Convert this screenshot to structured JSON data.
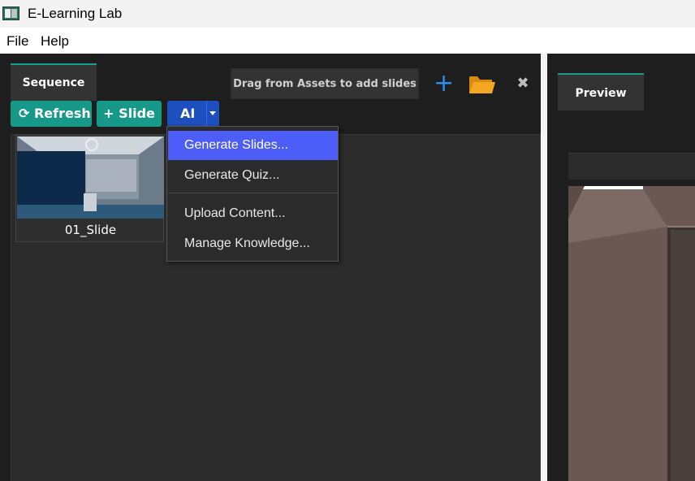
{
  "window": {
    "title": "E-Learning Lab"
  },
  "menu": {
    "items": [
      "File",
      "Help"
    ]
  },
  "sequence": {
    "tab_label": "Sequence",
    "drag_hint": "Drag from Assets to add slides",
    "refresh_label": "Refresh",
    "add_slide_label": "+ Slide",
    "ai_label": "AI",
    "slides": [
      {
        "label": "01_Slide"
      }
    ]
  },
  "ai_menu": {
    "items": [
      "Generate Slides...",
      "Generate Quiz...",
      "Upload Content...",
      "Manage Knowledge..."
    ],
    "active_index": 0
  },
  "preview": {
    "tab_label": "Preview"
  },
  "colors": {
    "accent_teal": "#17998a",
    "ai_blue": "#1d4fbf",
    "menu_highlight": "#4c5ef7",
    "add_icon": "#2d8cf0",
    "folder_icon": "#f5a623"
  },
  "icons": {
    "refresh": "refresh-icon",
    "add": "plus-icon",
    "folder": "folder-icon",
    "close": "close-icon",
    "dropdown": "caret-down-icon"
  }
}
